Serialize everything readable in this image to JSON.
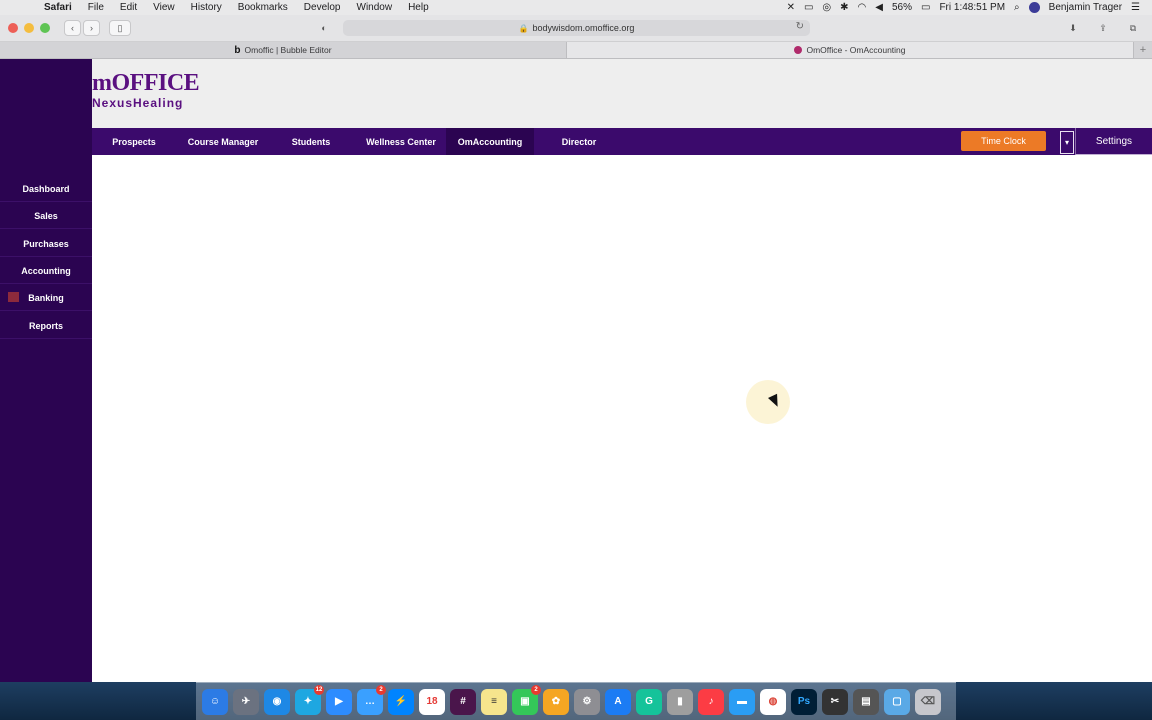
{
  "menubar": {
    "app": "Safari",
    "items": [
      "File",
      "Edit",
      "View",
      "History",
      "Bookmarks",
      "Develop",
      "Window",
      "Help"
    ],
    "battery": "56%",
    "clock": "Fri 1:48:51 PM",
    "user": "Benjamin Trager"
  },
  "browser": {
    "url": "bodywisdom.omoffice.org",
    "tabs": [
      {
        "title": "Omoffic | Bubble Editor",
        "favicon": "b"
      },
      {
        "title": "OmOffice - OmAccounting"
      }
    ]
  },
  "app": {
    "logo": {
      "line1": "mOFFICE",
      "line2": "NexusHealing"
    },
    "sidebar": [
      {
        "label": "Dashboard"
      },
      {
        "label": "Sales"
      },
      {
        "label": "Purchases"
      },
      {
        "label": "Accounting"
      },
      {
        "label": "Banking"
      },
      {
        "label": "Reports"
      }
    ],
    "nav": [
      {
        "label": "Prospects"
      },
      {
        "label": "Course Manager"
      },
      {
        "label": "Students"
      },
      {
        "label": "Wellness Center"
      },
      {
        "label": "OmAccounting"
      },
      {
        "label": "Director"
      }
    ],
    "time_clock": "Time Clock",
    "settings": "Settings",
    "colors": {
      "sidebar": "#2b0451",
      "nav": "#3b0a6c",
      "accent": "#ec7a26",
      "brand": "#5a1080"
    }
  },
  "dock": {
    "badges": {
      "appstore": "12",
      "messages": "2",
      "facetime": "2"
    },
    "calendar_day": "18"
  }
}
